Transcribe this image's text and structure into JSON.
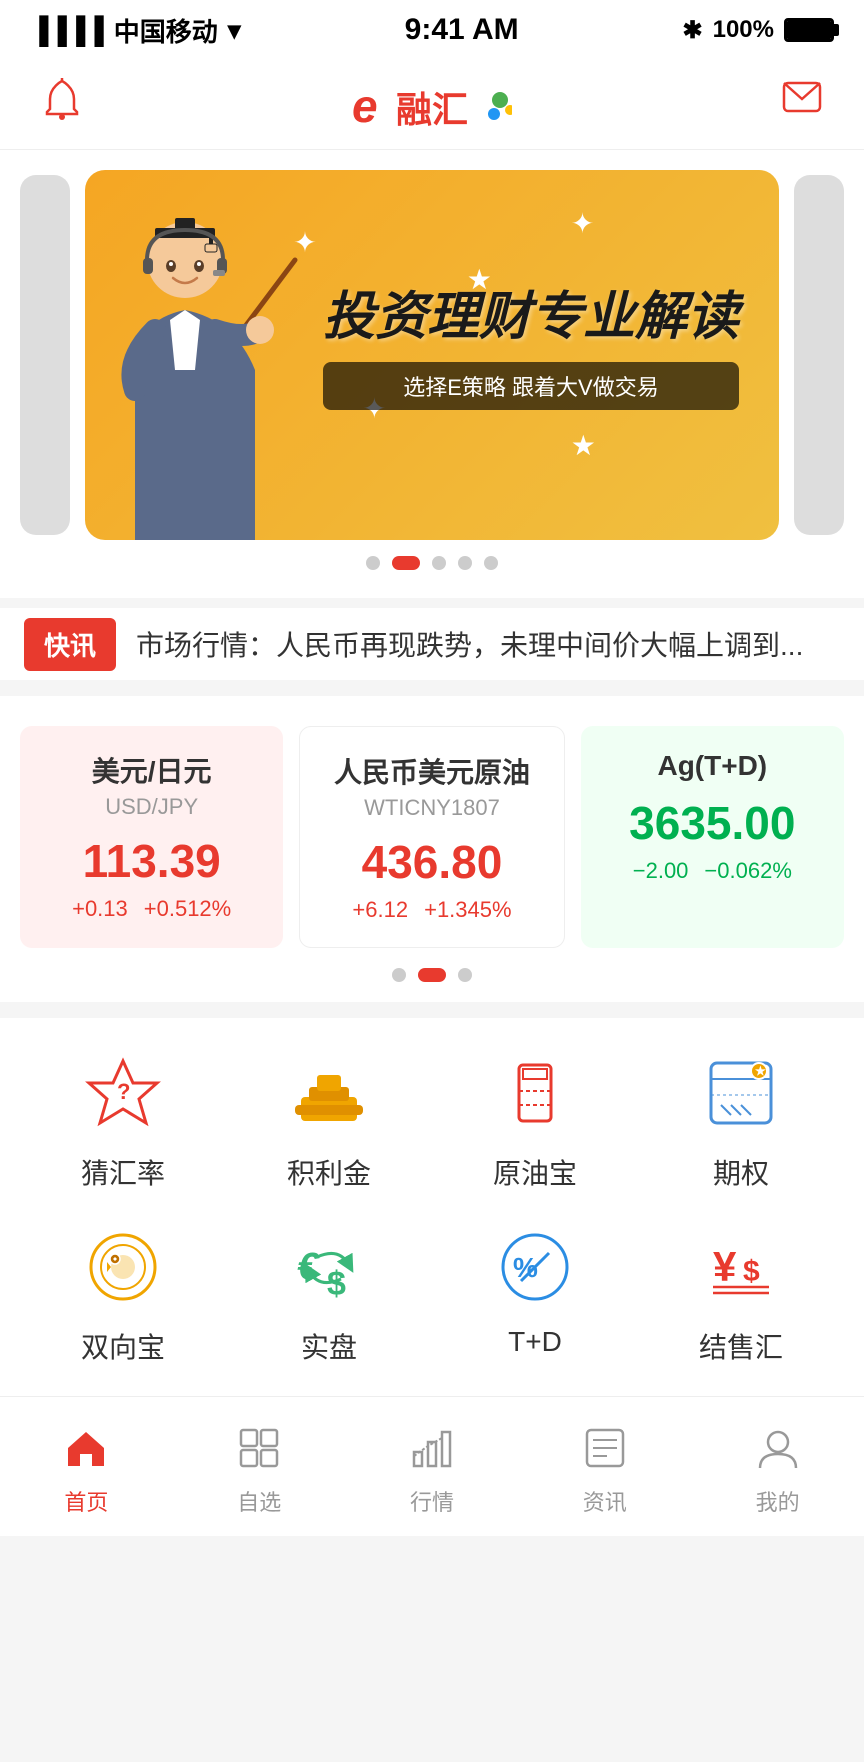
{
  "statusBar": {
    "carrier": "中国移动",
    "time": "9:41 AM",
    "battery": "100%"
  },
  "header": {
    "logo": "e融汇",
    "logoSymbol": "e",
    "logoText": "融汇"
  },
  "banner": {
    "title": "投资理财专业解读",
    "subtitle": "选择E策略 跟着大V做交易",
    "dots": [
      {
        "active": false
      },
      {
        "active": true
      },
      {
        "active": false
      },
      {
        "active": false
      },
      {
        "active": false
      }
    ]
  },
  "news": {
    "badge": "快讯",
    "text": "市场行情：人民币再现跌势，未理中间价大幅上调到..."
  },
  "market": {
    "cards": [
      {
        "name": "美元/日元",
        "code": "USD/JPY",
        "price": "113.39",
        "change1": "+0.13",
        "change2": "+0.512%",
        "colorClass": "red",
        "bgClass": "red-bg"
      },
      {
        "name": "人民币美元原油",
        "code": "WTICNY1807",
        "price": "436.80",
        "change1": "+6.12",
        "change2": "+1.345%",
        "colorClass": "red",
        "bgClass": "white-bg"
      },
      {
        "name": "Ag(T+D)",
        "code": "",
        "price": "3635.00",
        "change1": "−2.00",
        "change2": "−0.062%",
        "colorClass": "green",
        "bgClass": "green-bg"
      }
    ],
    "dots": [
      {
        "active": false
      },
      {
        "active": true
      },
      {
        "active": false
      }
    ]
  },
  "menu": {
    "items": [
      {
        "id": "guess-rate",
        "label": "猜汇率",
        "color": "#e83a2e"
      },
      {
        "id": "gold",
        "label": "积利金",
        "color": "#f0a500"
      },
      {
        "id": "oil",
        "label": "原油宝",
        "color": "#e83a2e"
      },
      {
        "id": "options",
        "label": "期权",
        "color": "#4a90d9"
      },
      {
        "id": "two-way",
        "label": "双向宝",
        "color": "#f0a500"
      },
      {
        "id": "live",
        "label": "实盘",
        "color": "#3ab87a"
      },
      {
        "id": "td",
        "label": "T+D",
        "color": "#2b8de3"
      },
      {
        "id": "settlement",
        "label": "结售汇",
        "color": "#e83a2e"
      }
    ]
  },
  "bottomNav": {
    "items": [
      {
        "id": "home",
        "label": "首页",
        "active": true
      },
      {
        "id": "watchlist",
        "label": "自选",
        "active": false
      },
      {
        "id": "market",
        "label": "行情",
        "active": false
      },
      {
        "id": "news",
        "label": "资讯",
        "active": false
      },
      {
        "id": "profile",
        "label": "我的",
        "active": false
      }
    ]
  }
}
